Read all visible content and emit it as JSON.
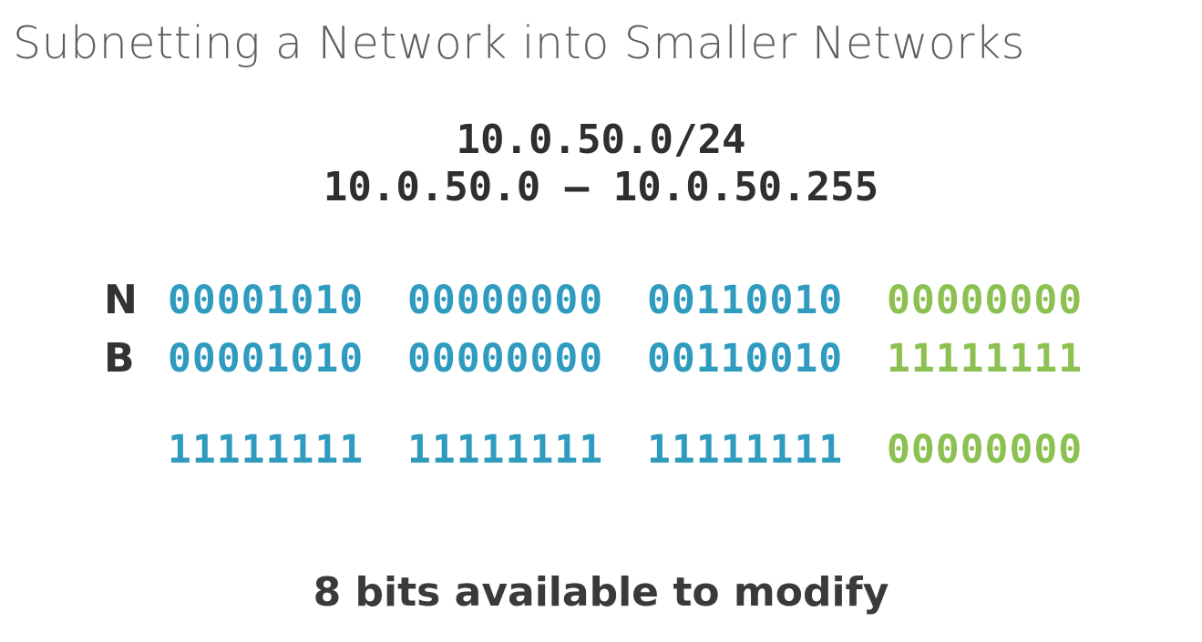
{
  "slide": {
    "title": "Subnetting a Network into Smaller Networks",
    "cidr": "10.0.50.0/24",
    "range": "10.0.50.0 – 10.0.50.255",
    "rows": {
      "network": {
        "label": "N",
        "octets": [
          "00001010",
          "00000000",
          "00110010",
          "00000000"
        ]
      },
      "broadcast": {
        "label": "B",
        "octets": [
          "00001010",
          "00000000",
          "00110010",
          "11111111"
        ]
      },
      "mask": {
        "octets": [
          "11111111",
          "11111111",
          "11111111",
          "00000000"
        ]
      }
    },
    "footer": "8 bits available to modify"
  },
  "colors": {
    "network_bits": "#2e9bbf",
    "host_bits": "#8cc152",
    "title_text": "#5e5e5e",
    "body_text": "#2f2f2f"
  }
}
